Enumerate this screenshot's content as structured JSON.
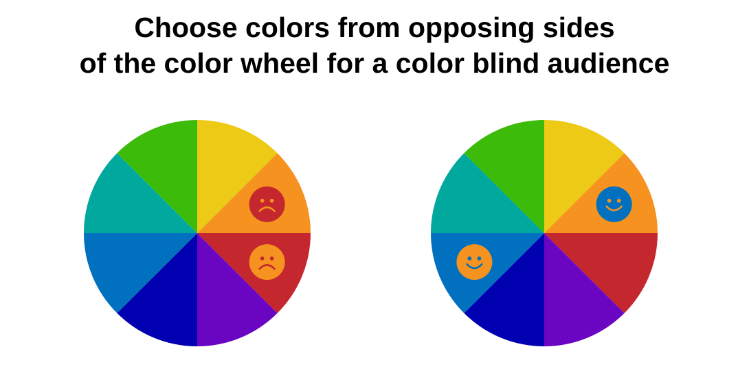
{
  "title": {
    "line1": "Choose colors from opposing sides",
    "line2": "of the color wheel for a color blind audience"
  },
  "palette": {
    "background": "#ffffff",
    "title": "#000000",
    "segments": [
      {
        "name": "yellow",
        "color": "#ECCA16"
      },
      {
        "name": "orange",
        "color": "#F59220"
      },
      {
        "name": "red",
        "color": "#C4272E"
      },
      {
        "name": "violet",
        "color": "#6A05C2"
      },
      {
        "name": "dark-blue",
        "color": "#0000B0"
      },
      {
        "name": "blue",
        "color": "#0070BF"
      },
      {
        "name": "teal",
        "color": "#00A89E"
      },
      {
        "name": "green",
        "color": "#3CBB0A"
      }
    ]
  },
  "wheels": [
    {
      "id": "left",
      "faces": [
        {
          "segment": "orange",
          "expression": "sad",
          "face_color": "#C4272E",
          "feature_color": "#F59220"
        },
        {
          "segment": "red",
          "expression": "sad",
          "face_color": "#F59220",
          "feature_color": "#C4272E"
        }
      ]
    },
    {
      "id": "right",
      "faces": [
        {
          "segment": "orange",
          "expression": "happy",
          "face_color": "#0070BF",
          "feature_color": "#F59220"
        },
        {
          "segment": "blue",
          "expression": "happy",
          "face_color": "#F59220",
          "feature_color": "#0070BF"
        }
      ]
    }
  ]
}
